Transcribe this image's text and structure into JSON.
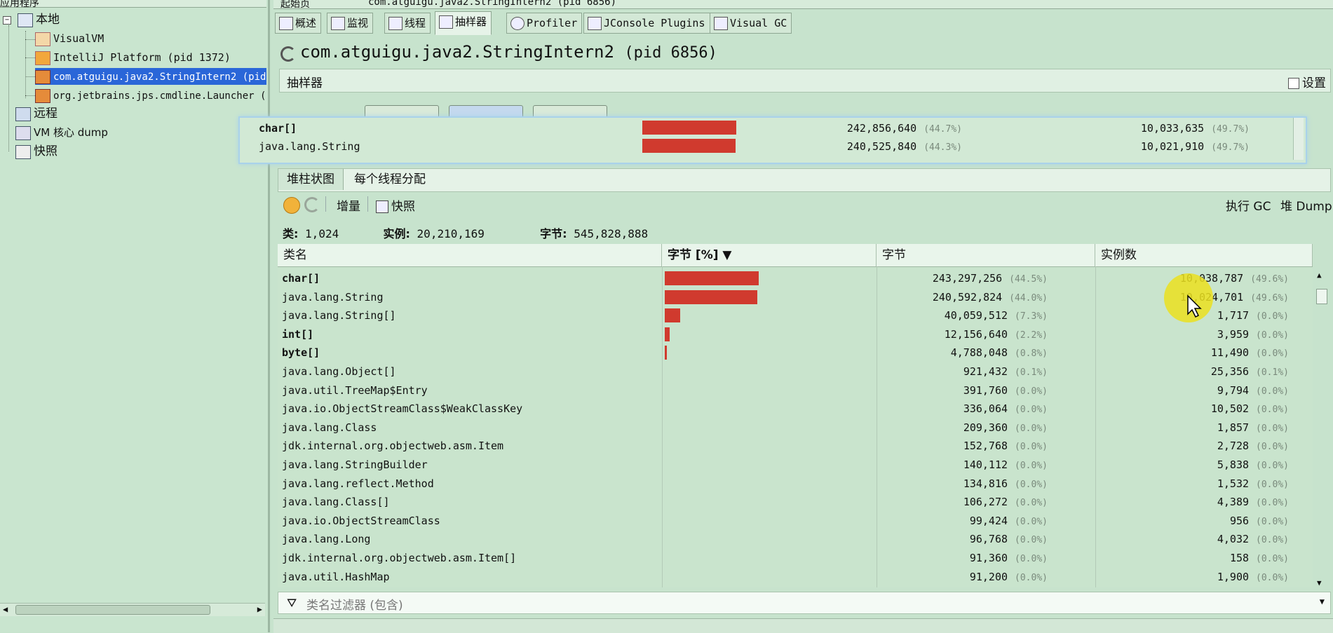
{
  "left_panel": {
    "tab_title": "应用程序",
    "tree": {
      "local": "本地",
      "local_items": [
        "VisualVM",
        "IntelliJ Platform (pid 1372)",
        "com.atguigu.java2.StringIntern2 (pid",
        "org.jetbrains.jps.cmdline.Launcher ("
      ],
      "remote": "远程",
      "core_dump": "VM 核心 dump",
      "snapshots": "快照"
    },
    "selected_index": 2
  },
  "doc_tabs": [
    "起始页",
    "com.atguigu.java2.StringIntern2 (pid 6856)"
  ],
  "view_tabs": [
    "概述",
    "监视",
    "线程",
    "抽样器",
    "Profiler",
    "JConsole Plugins",
    "Visual GC"
  ],
  "active_view_tab": 3,
  "title": {
    "main": "com.atguigu.java2.StringIntern2",
    "pid": "(pid 6856)"
  },
  "sampler_label": "抽样器",
  "settings_label": "设置",
  "overlay_rows": [
    {
      "name": "char[]",
      "bar": 0.445,
      "bytes": "242,856,640",
      "bytes_pct": "(44.7%)",
      "inst": "10,033,635",
      "inst_pct": "(49.7%)"
    },
    {
      "name": "java.lang.String",
      "bar": 0.443,
      "bytes": "240,525,840",
      "bytes_pct": "(44.3%)",
      "inst": "10,021,910",
      "inst_pct": "(49.7%)"
    }
  ],
  "sub_tabs": [
    "堆柱状图",
    "每个线程分配"
  ],
  "toolbar": {
    "delta": "增量",
    "snapshot": "快照",
    "gc": "执行 GC",
    "heap_dump": "堆 Dump"
  },
  "stats": {
    "classes_label": "类:",
    "classes": "1,024",
    "instances_label": "实例:",
    "instances": "20,210,169",
    "bytes_label": "字节:",
    "bytes": "545,828,888"
  },
  "table": {
    "columns": [
      "类名",
      "字节 [%] ▼",
      "字节",
      "实例数"
    ],
    "rows": [
      {
        "name": "char[]",
        "bar": 0.445,
        "bytes": "243,297,256",
        "bytes_pct": "(44.5%)",
        "inst": "10,038,787",
        "inst_pct": "(49.6%)"
      },
      {
        "name": "java.lang.String",
        "bar": 0.44,
        "bytes": "240,592,824",
        "bytes_pct": "(44.0%)",
        "inst": "10,024,701",
        "inst_pct": "(49.6%)"
      },
      {
        "name": "java.lang.String[]",
        "bar": 0.073,
        "bytes": "40,059,512",
        "bytes_pct": "(7.3%)",
        "inst": "1,717",
        "inst_pct": "(0.0%)"
      },
      {
        "name": "int[]",
        "bar": 0.022,
        "bytes": "12,156,640",
        "bytes_pct": "(2.2%)",
        "inst": "3,959",
        "inst_pct": "(0.0%)"
      },
      {
        "name": "byte[]",
        "bar": 0.008,
        "bytes": "4,788,048",
        "bytes_pct": "(0.8%)",
        "inst": "11,490",
        "inst_pct": "(0.0%)"
      },
      {
        "name": "java.lang.Object[]",
        "bar": 0,
        "bytes": "921,432",
        "bytes_pct": "(0.1%)",
        "inst": "25,356",
        "inst_pct": "(0.1%)"
      },
      {
        "name": "java.util.TreeMap$Entry",
        "bar": 0,
        "bytes": "391,760",
        "bytes_pct": "(0.0%)",
        "inst": "9,794",
        "inst_pct": "(0.0%)"
      },
      {
        "name": "java.io.ObjectStreamClass$WeakClassKey",
        "bar": 0,
        "bytes": "336,064",
        "bytes_pct": "(0.0%)",
        "inst": "10,502",
        "inst_pct": "(0.0%)"
      },
      {
        "name": "java.lang.Class",
        "bar": 0,
        "bytes": "209,360",
        "bytes_pct": "(0.0%)",
        "inst": "1,857",
        "inst_pct": "(0.0%)"
      },
      {
        "name": "jdk.internal.org.objectweb.asm.Item",
        "bar": 0,
        "bytes": "152,768",
        "bytes_pct": "(0.0%)",
        "inst": "2,728",
        "inst_pct": "(0.0%)"
      },
      {
        "name": "java.lang.StringBuilder",
        "bar": 0,
        "bytes": "140,112",
        "bytes_pct": "(0.0%)",
        "inst": "5,838",
        "inst_pct": "(0.0%)"
      },
      {
        "name": "java.lang.reflect.Method",
        "bar": 0,
        "bytes": "134,816",
        "bytes_pct": "(0.0%)",
        "inst": "1,532",
        "inst_pct": "(0.0%)"
      },
      {
        "name": "java.lang.Class[]",
        "bar": 0,
        "bytes": "106,272",
        "bytes_pct": "(0.0%)",
        "inst": "4,389",
        "inst_pct": "(0.0%)"
      },
      {
        "name": "java.io.ObjectStreamClass",
        "bar": 0,
        "bytes": "99,424",
        "bytes_pct": "(0.0%)",
        "inst": "956",
        "inst_pct": "(0.0%)"
      },
      {
        "name": "java.lang.Long",
        "bar": 0,
        "bytes": "96,768",
        "bytes_pct": "(0.0%)",
        "inst": "4,032",
        "inst_pct": "(0.0%)"
      },
      {
        "name": "jdk.internal.org.objectweb.asm.Item[]",
        "bar": 0,
        "bytes": "91,360",
        "bytes_pct": "(0.0%)",
        "inst": "158",
        "inst_pct": "(0.0%)"
      },
      {
        "name": "java.util.HashMap",
        "bar": 0,
        "bytes": "91,200",
        "bytes_pct": "(0.0%)",
        "inst": "1,900",
        "inst_pct": "(0.0%)"
      }
    ]
  },
  "filter_placeholder": "类名过滤器 (包含)",
  "colors": {
    "bar": "#d03a2e",
    "selection": "#2a66d8",
    "bg": "#c7e3cd"
  }
}
